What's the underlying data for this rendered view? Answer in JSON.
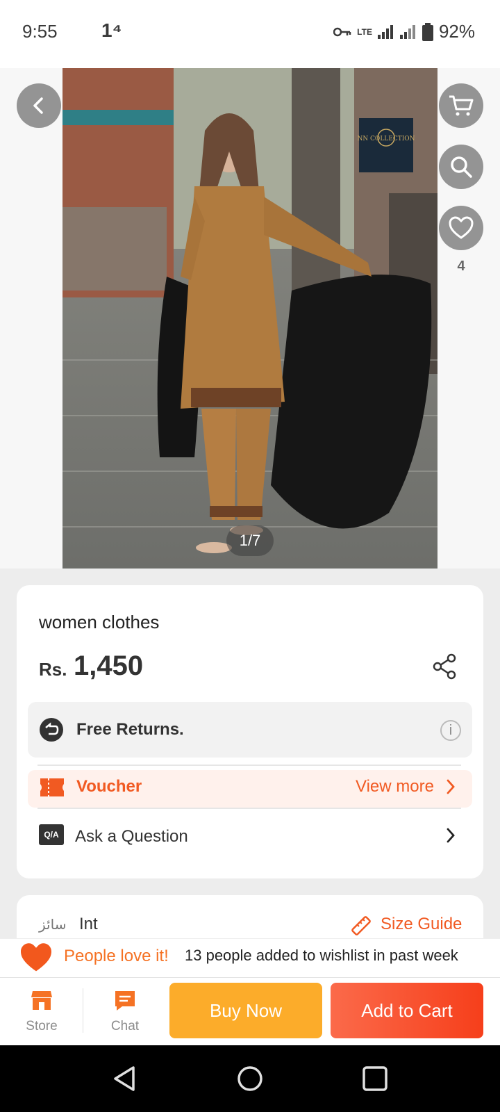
{
  "status_bar": {
    "time": "9:55",
    "notification": "1⁴",
    "network": "LTE",
    "battery": "92%"
  },
  "gallery": {
    "brand_badge_text": "NN COLLECTION",
    "wishlist_count": "4",
    "pager": "1/7"
  },
  "product": {
    "title": "women clothes",
    "currency": "Rs.",
    "price": "1,450",
    "returns": "Free Returns.",
    "voucher_label": "Voucher",
    "voucher_link": "View more",
    "qa_badge": "Q/A",
    "qa_label": "Ask a Question"
  },
  "size": {
    "label_urdu": "سائز",
    "value": "Int",
    "guide": "Size Guide"
  },
  "wishlist_banner": {
    "highlight": "People love it!",
    "detail": "13 people added to wishlist in past week"
  },
  "actions": {
    "store": "Store",
    "chat": "Chat",
    "buy_now": "Buy Now",
    "add_to_cart": "Add to Cart"
  },
  "colors": {
    "accent": "#f15a22",
    "buy_now": "#fcac2a",
    "add_to_cart": "#f63f1b"
  }
}
